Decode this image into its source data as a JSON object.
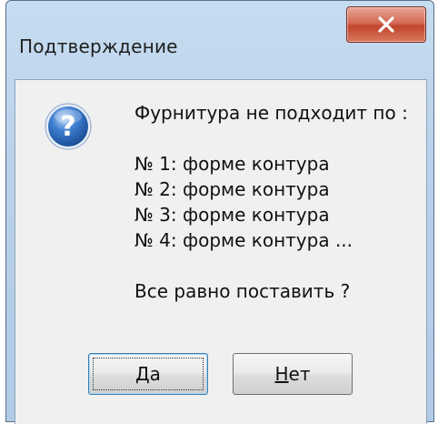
{
  "dialog": {
    "title": "Подтверждение",
    "close_label": "x"
  },
  "icon": {
    "name": "question-icon",
    "glyph": "?",
    "colors": {
      "outer": "#1b4f98",
      "inner": "#3f7fd0",
      "highlight": "#bcd8f7"
    }
  },
  "message": {
    "heading": "Фурнитура не подходит по :",
    "items": [
      "№ 1: форме контура",
      "№ 2: форме контура",
      "№ 3: форме контура",
      "№ 4: форме контура ..."
    ],
    "question": "Все равно поставить ?"
  },
  "buttons": {
    "yes": {
      "mnemonic": "Д",
      "rest": "а"
    },
    "no": {
      "mnemonic": "Н",
      "rest": "ет"
    }
  }
}
